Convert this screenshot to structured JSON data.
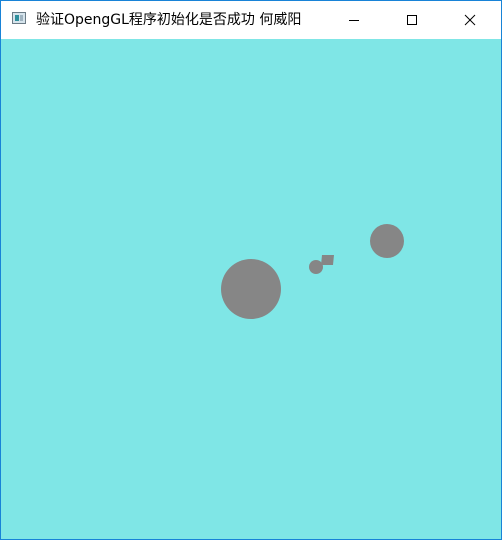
{
  "window": {
    "title": "验证OpengGL程序初始化是否成功 何威阳",
    "app_icon": "opengl-window-icon",
    "controls": {
      "minimize_icon": "minimize-icon",
      "maximize_icon": "maximize-icon",
      "close_icon": "close-icon"
    }
  },
  "viewport": {
    "clear_color": "#7fe6e6",
    "object_color": "#868686"
  }
}
